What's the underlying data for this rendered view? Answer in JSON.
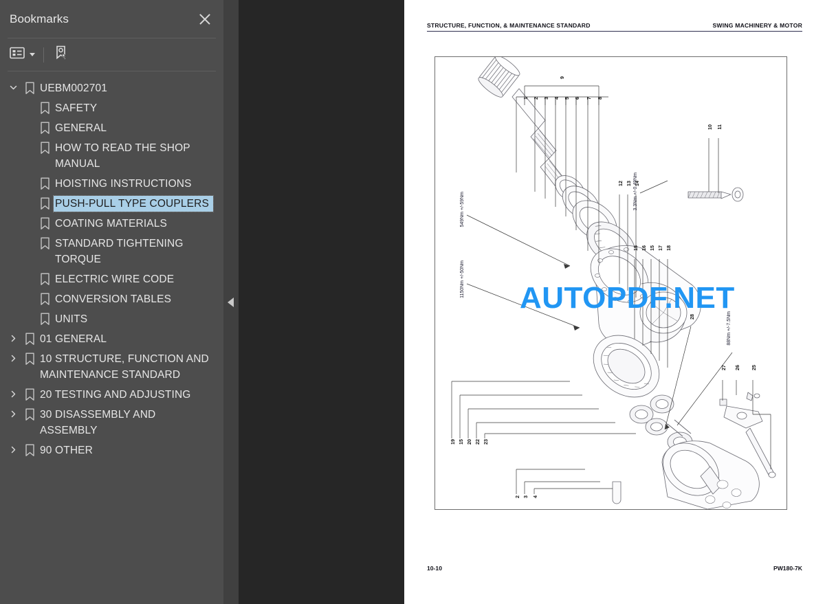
{
  "sidebar": {
    "title": "Bookmarks",
    "close_label": "×",
    "toolbar": {
      "options_icon": "list-options-icon",
      "options_caret": "chevron-down-icon",
      "find_bookmark_icon": "find-current-bookmark-icon"
    },
    "items": [
      {
        "label": "UEBM002701",
        "level": 0,
        "twisty": "expanded",
        "selected": false
      },
      {
        "label": "SAFETY",
        "level": 1,
        "twisty": "none",
        "selected": false
      },
      {
        "label": "GENERAL",
        "level": 1,
        "twisty": "none",
        "selected": false
      },
      {
        "label": "HOW TO READ THE SHOP MANUAL",
        "level": 1,
        "twisty": "none",
        "selected": false
      },
      {
        "label": "HOISTING INSTRUCTIONS",
        "level": 1,
        "twisty": "none",
        "selected": false
      },
      {
        "label": "PUSH-PULL TYPE COUPLERS",
        "level": 1,
        "twisty": "none",
        "selected": true
      },
      {
        "label": "COATING MATERIALS",
        "level": 1,
        "twisty": "none",
        "selected": false
      },
      {
        "label": "STANDARD TIGHTENING TORQUE",
        "level": 1,
        "twisty": "none",
        "selected": false
      },
      {
        "label": "ELECTRIC WIRE CODE",
        "level": 1,
        "twisty": "none",
        "selected": false
      },
      {
        "label": "CONVERSION TABLES",
        "level": 1,
        "twisty": "none",
        "selected": false
      },
      {
        "label": "UNITS",
        "level": 1,
        "twisty": "none",
        "selected": false
      },
      {
        "label": "01 GENERAL",
        "level": 1,
        "twisty": "collapsed",
        "selected": false
      },
      {
        "label": "10 STRUCTURE, FUNCTION AND MAINTENANCE STANDARD",
        "level": 1,
        "twisty": "collapsed",
        "selected": false
      },
      {
        "label": "20 TESTING AND ADJUSTING",
        "level": 1,
        "twisty": "collapsed",
        "selected": false
      },
      {
        "label": "30 DISASSEMBLY AND ASSEMBLY",
        "level": 1,
        "twisty": "collapsed",
        "selected": false
      },
      {
        "label": "90 OTHER",
        "level": 1,
        "twisty": "collapsed",
        "selected": false
      }
    ]
  },
  "splitter": {
    "collapse_icon": "collapse-left-triangle-icon"
  },
  "document": {
    "header_left": "STRUCTURE, FUNCTION, & MAINTENANCE STANDARD",
    "header_right": "SWING MACHINERY & MOTOR",
    "footer_left": "10-10",
    "footer_right": "PW180-7K",
    "figure": {
      "name": "swing-machinery-and-motor-exploded-view",
      "torque_notes": [
        "549Nm +/-59Nm",
        "1150Nm +/-50Nm",
        "3.3Nm +/-0.49Nm",
        "88Nm +/-7.5Nm"
      ],
      "callouts_top": [
        "1",
        "2",
        "3",
        "4",
        "5",
        "6",
        "7",
        "8"
      ],
      "callout_bracket": "9",
      "callouts_right_upper": [
        "10",
        "11"
      ],
      "callouts_mid_left": [
        "12",
        "13",
        "14"
      ],
      "callouts_mid_right": [
        "15",
        "16",
        "15",
        "17",
        "18"
      ],
      "callout_arrow": "28",
      "callouts_lower_left": [
        "19",
        "15",
        "20",
        "22",
        "23"
      ],
      "callouts_lower_right": [
        "27",
        "26",
        "25"
      ],
      "callouts_bottom": [
        "2",
        "3",
        "4"
      ]
    }
  },
  "watermark": {
    "text": "AUTOPDF.NET",
    "color": "#2196f3"
  },
  "colors": {
    "sidebar_bg": "#4d4d4d",
    "splitter_bg": "#404040",
    "viewer_bg": "#262626",
    "page_bg": "#ffffff",
    "selection": "#a9cfe7"
  }
}
